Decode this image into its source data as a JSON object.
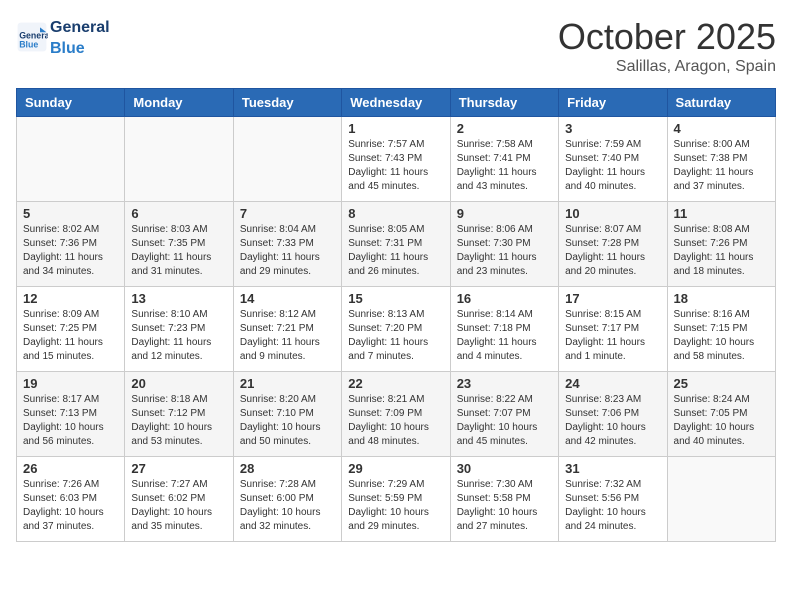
{
  "header": {
    "logo_general": "General",
    "logo_blue": "Blue",
    "month": "October 2025",
    "location": "Salillas, Aragon, Spain"
  },
  "weekdays": [
    "Sunday",
    "Monday",
    "Tuesday",
    "Wednesday",
    "Thursday",
    "Friday",
    "Saturday"
  ],
  "weeks": [
    [
      {
        "day": "",
        "info": ""
      },
      {
        "day": "",
        "info": ""
      },
      {
        "day": "",
        "info": ""
      },
      {
        "day": "1",
        "info": "Sunrise: 7:57 AM\nSunset: 7:43 PM\nDaylight: 11 hours\nand 45 minutes."
      },
      {
        "day": "2",
        "info": "Sunrise: 7:58 AM\nSunset: 7:41 PM\nDaylight: 11 hours\nand 43 minutes."
      },
      {
        "day": "3",
        "info": "Sunrise: 7:59 AM\nSunset: 7:40 PM\nDaylight: 11 hours\nand 40 minutes."
      },
      {
        "day": "4",
        "info": "Sunrise: 8:00 AM\nSunset: 7:38 PM\nDaylight: 11 hours\nand 37 minutes."
      }
    ],
    [
      {
        "day": "5",
        "info": "Sunrise: 8:02 AM\nSunset: 7:36 PM\nDaylight: 11 hours\nand 34 minutes."
      },
      {
        "day": "6",
        "info": "Sunrise: 8:03 AM\nSunset: 7:35 PM\nDaylight: 11 hours\nand 31 minutes."
      },
      {
        "day": "7",
        "info": "Sunrise: 8:04 AM\nSunset: 7:33 PM\nDaylight: 11 hours\nand 29 minutes."
      },
      {
        "day": "8",
        "info": "Sunrise: 8:05 AM\nSunset: 7:31 PM\nDaylight: 11 hours\nand 26 minutes."
      },
      {
        "day": "9",
        "info": "Sunrise: 8:06 AM\nSunset: 7:30 PM\nDaylight: 11 hours\nand 23 minutes."
      },
      {
        "day": "10",
        "info": "Sunrise: 8:07 AM\nSunset: 7:28 PM\nDaylight: 11 hours\nand 20 minutes."
      },
      {
        "day": "11",
        "info": "Sunrise: 8:08 AM\nSunset: 7:26 PM\nDaylight: 11 hours\nand 18 minutes."
      }
    ],
    [
      {
        "day": "12",
        "info": "Sunrise: 8:09 AM\nSunset: 7:25 PM\nDaylight: 11 hours\nand 15 minutes."
      },
      {
        "day": "13",
        "info": "Sunrise: 8:10 AM\nSunset: 7:23 PM\nDaylight: 11 hours\nand 12 minutes."
      },
      {
        "day": "14",
        "info": "Sunrise: 8:12 AM\nSunset: 7:21 PM\nDaylight: 11 hours\nand 9 minutes."
      },
      {
        "day": "15",
        "info": "Sunrise: 8:13 AM\nSunset: 7:20 PM\nDaylight: 11 hours\nand 7 minutes."
      },
      {
        "day": "16",
        "info": "Sunrise: 8:14 AM\nSunset: 7:18 PM\nDaylight: 11 hours\nand 4 minutes."
      },
      {
        "day": "17",
        "info": "Sunrise: 8:15 AM\nSunset: 7:17 PM\nDaylight: 11 hours\nand 1 minute."
      },
      {
        "day": "18",
        "info": "Sunrise: 8:16 AM\nSunset: 7:15 PM\nDaylight: 10 hours\nand 58 minutes."
      }
    ],
    [
      {
        "day": "19",
        "info": "Sunrise: 8:17 AM\nSunset: 7:13 PM\nDaylight: 10 hours\nand 56 minutes."
      },
      {
        "day": "20",
        "info": "Sunrise: 8:18 AM\nSunset: 7:12 PM\nDaylight: 10 hours\nand 53 minutes."
      },
      {
        "day": "21",
        "info": "Sunrise: 8:20 AM\nSunset: 7:10 PM\nDaylight: 10 hours\nand 50 minutes."
      },
      {
        "day": "22",
        "info": "Sunrise: 8:21 AM\nSunset: 7:09 PM\nDaylight: 10 hours\nand 48 minutes."
      },
      {
        "day": "23",
        "info": "Sunrise: 8:22 AM\nSunset: 7:07 PM\nDaylight: 10 hours\nand 45 minutes."
      },
      {
        "day": "24",
        "info": "Sunrise: 8:23 AM\nSunset: 7:06 PM\nDaylight: 10 hours\nand 42 minutes."
      },
      {
        "day": "25",
        "info": "Sunrise: 8:24 AM\nSunset: 7:05 PM\nDaylight: 10 hours\nand 40 minutes."
      }
    ],
    [
      {
        "day": "26",
        "info": "Sunrise: 7:26 AM\nSunset: 6:03 PM\nDaylight: 10 hours\nand 37 minutes."
      },
      {
        "day": "27",
        "info": "Sunrise: 7:27 AM\nSunset: 6:02 PM\nDaylight: 10 hours\nand 35 minutes."
      },
      {
        "day": "28",
        "info": "Sunrise: 7:28 AM\nSunset: 6:00 PM\nDaylight: 10 hours\nand 32 minutes."
      },
      {
        "day": "29",
        "info": "Sunrise: 7:29 AM\nSunset: 5:59 PM\nDaylight: 10 hours\nand 29 minutes."
      },
      {
        "day": "30",
        "info": "Sunrise: 7:30 AM\nSunset: 5:58 PM\nDaylight: 10 hours\nand 27 minutes."
      },
      {
        "day": "31",
        "info": "Sunrise: 7:32 AM\nSunset: 5:56 PM\nDaylight: 10 hours\nand 24 minutes."
      },
      {
        "day": "",
        "info": ""
      }
    ]
  ]
}
